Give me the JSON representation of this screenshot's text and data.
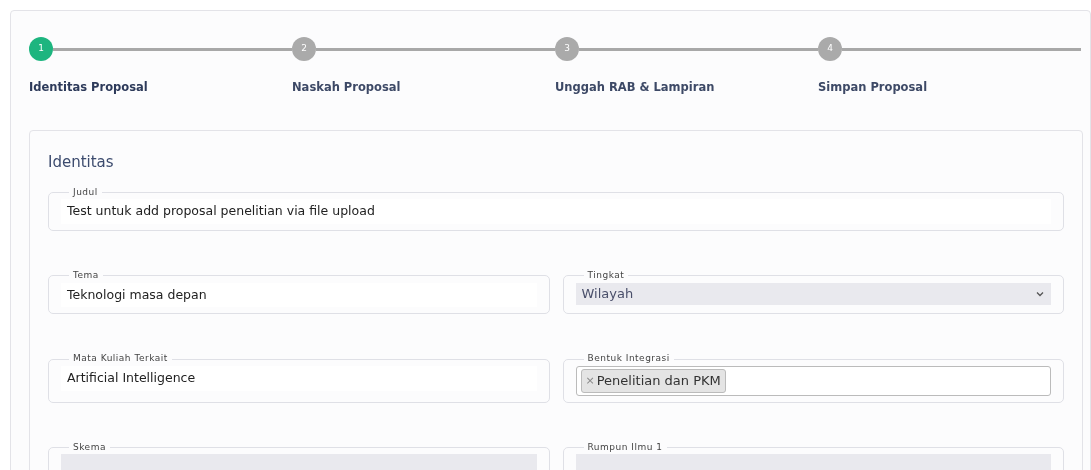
{
  "steps": [
    {
      "number": "1",
      "label": "Identitas Proposal",
      "selected": true
    },
    {
      "number": "2",
      "label": "Naskah Proposal",
      "selected": false
    },
    {
      "number": "3",
      "label": "Unggah RAB & Lampiran",
      "selected": false
    },
    {
      "number": "4",
      "label": "Simpan Proposal",
      "selected": false
    }
  ],
  "section": {
    "title": "Identitas",
    "rows": [
      [
        {
          "kind": "text",
          "label": "Judul",
          "value": "Test untuk add proposal penelitian via file upload"
        }
      ],
      [
        {
          "kind": "text",
          "label": "Tema",
          "value": "Teknologi masa depan"
        },
        {
          "kind": "select",
          "label": "Tingkat",
          "value": "Wilayah"
        }
      ],
      [
        {
          "kind": "text",
          "label": "Mata Kuliah Terkait",
          "value": "Artificial Intelligence"
        },
        {
          "kind": "tags",
          "label": "Bentuk Integrasi",
          "tags": [
            {
              "remove": "×",
              "label": "Penelitian dan PKM"
            }
          ]
        }
      ],
      [
        {
          "kind": "select",
          "label": "Skema"
        },
        {
          "kind": "select",
          "label": "Rumpun Ilmu 1"
        }
      ]
    ]
  }
}
